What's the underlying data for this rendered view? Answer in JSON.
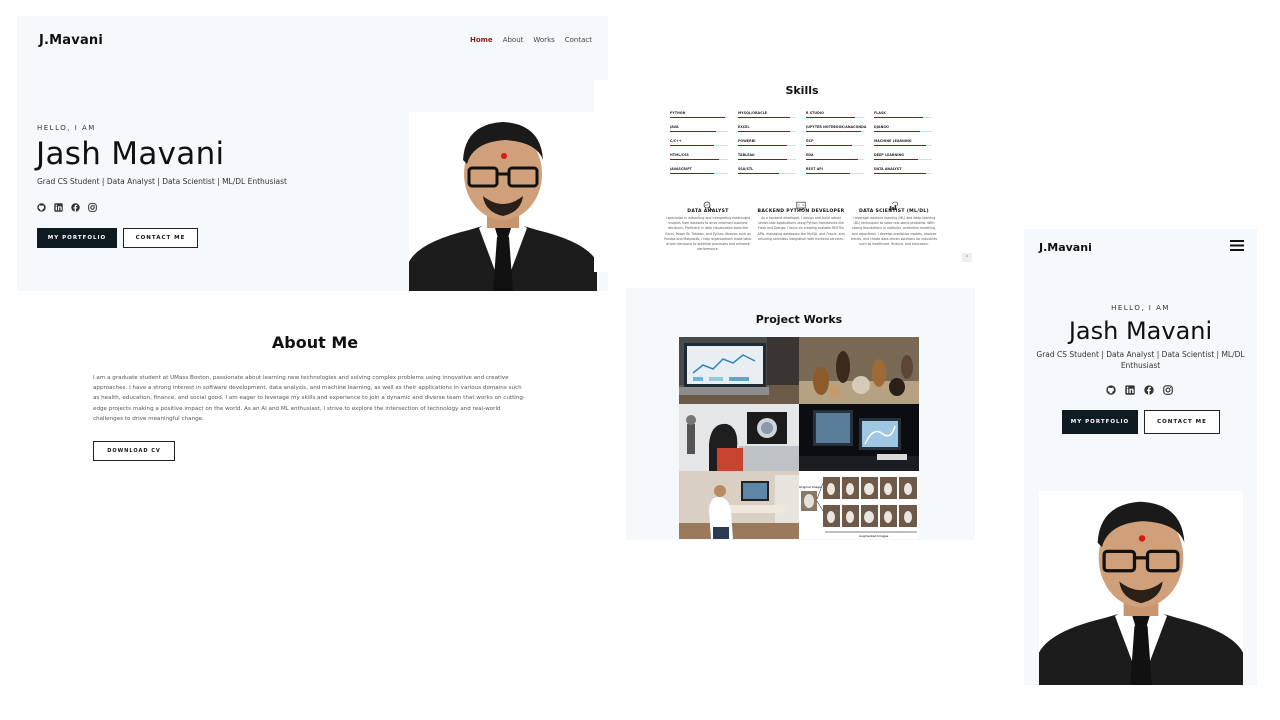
{
  "brand": {
    "logo": "J.Mavani",
    "accent": "#8b1a1a",
    "dark": "#0f1b22"
  },
  "nav": {
    "items": [
      "Home",
      "About",
      "Works",
      "Contact"
    ],
    "active": "Home"
  },
  "hero": {
    "greeting": "HELLO, I AM",
    "name": "Jash Mavani",
    "tagline": "Grad CS Student | Data Analyst | Data Scientist | ML/DL Enthusiast",
    "socials": [
      "github-icon",
      "linkedin-icon",
      "facebook-icon",
      "instagram-icon"
    ],
    "primary_button": "MY PORTFOLIO",
    "secondary_button": "CONTACT ME"
  },
  "about": {
    "title": "About Me",
    "paragraph": "I am a graduate student at UMass Boston, passionate about learning new technologies and solving complex problems using innovative and creative approaches. I have a strong interest in software development, data analysis, and machine learning, as well as their applications in various domains such as health, education, finance, and social good. I am eager to leverage my skills and experience to join a dynamic and diverse team that works on cutting-edge projects making a positive impact on the world. As an AI and ML enthusiast, I strive to explore the intersection of technology and real-world challenges to drive meaningful change.",
    "button": "DOWNLOAD CV"
  },
  "skills": {
    "title": "Skills",
    "items": [
      {
        "name": "PYTHON",
        "level": 0.95
      },
      {
        "name": "MYSQL/ORACLE",
        "level": 0.9
      },
      {
        "name": "R STUDIO",
        "level": 0.85
      },
      {
        "name": "FLASK",
        "level": 0.85
      },
      {
        "name": "JAVA",
        "level": 0.8
      },
      {
        "name": "EXCEL",
        "level": 0.9
      },
      {
        "name": "JUPYTER NOTEBOOK/ANACONDA",
        "level": 0.95
      },
      {
        "name": "DJANGO",
        "level": 0.8
      },
      {
        "name": "C/C++",
        "level": 0.75
      },
      {
        "name": "POWERBI",
        "level": 0.85
      },
      {
        "name": "GCP",
        "level": 0.8
      },
      {
        "name": "MACHINE LEARNING",
        "level": 0.9
      },
      {
        "name": "HTML/CSS",
        "level": 0.85
      },
      {
        "name": "TABLEAU",
        "level": 0.85
      },
      {
        "name": "EDA",
        "level": 0.9
      },
      {
        "name": "DEEP LEARNING",
        "level": 0.75
      },
      {
        "name": "JAVASCRIPT",
        "level": 0.75
      },
      {
        "name": "SSA/STL",
        "level": 0.7
      },
      {
        "name": "REST API",
        "level": 0.75
      },
      {
        "name": "DATA ANALYST",
        "level": 0.9
      }
    ],
    "roles": [
      {
        "icon": "magnifier-chart-icon",
        "title": "DATA ANALYST",
        "desc": "I specialize in extracting and interpreting meaningful insights from datasets to drive informed business decisions. Proficient in data visualization tools like Excel, Power BI, Tableau, and Python libraries such as Pandas and Matplotlib, I help organizations make data-driven decisions to optimize processes and enhance performance."
      },
      {
        "icon": "monitor-code-icon",
        "title": "BACKEND PYTHON DEVELOPER",
        "desc": "As a backend developer, I design and build robust server-side applications using Python frameworks like Flask and Django. I focus on creating scalable RESTful APIs, managing databases like MySQL and Oracle, and ensuring seamless integration with frontend services."
      },
      {
        "icon": "brain-chart-icon",
        "title": "DATA SCIENTIST (ML/DL)",
        "desc": "I leverage machine learning (ML) and deep learning (DL) techniques to solve real-world problems. With strong foundations in statistics, predictive modeling, and algorithms, I develop predictive models, analyze trends, and create data-driven solutions for industries such as healthcare, finance, and education."
      }
    ]
  },
  "projects": {
    "title": "Project Works",
    "items": [
      "dashboard-laptop-image",
      "dogs-and-cats-image",
      "microscope-lab-image",
      "medical-imaging-image",
      "doctor-scan-image",
      "augmented-images-grid"
    ],
    "augmented_labels": {
      "original": "Original Image",
      "augmented": "Augmented Images"
    }
  },
  "mobile": {
    "logo": "J.Mavani",
    "greeting": "HELLO, I AM",
    "name": "Jash Mavani",
    "tagline": "Grad CS Student | Data Analyst | Data Scientist | ML/DL Enthusiast",
    "primary_button": "MY PORTFOLIO",
    "secondary_button": "CONTACT ME"
  }
}
